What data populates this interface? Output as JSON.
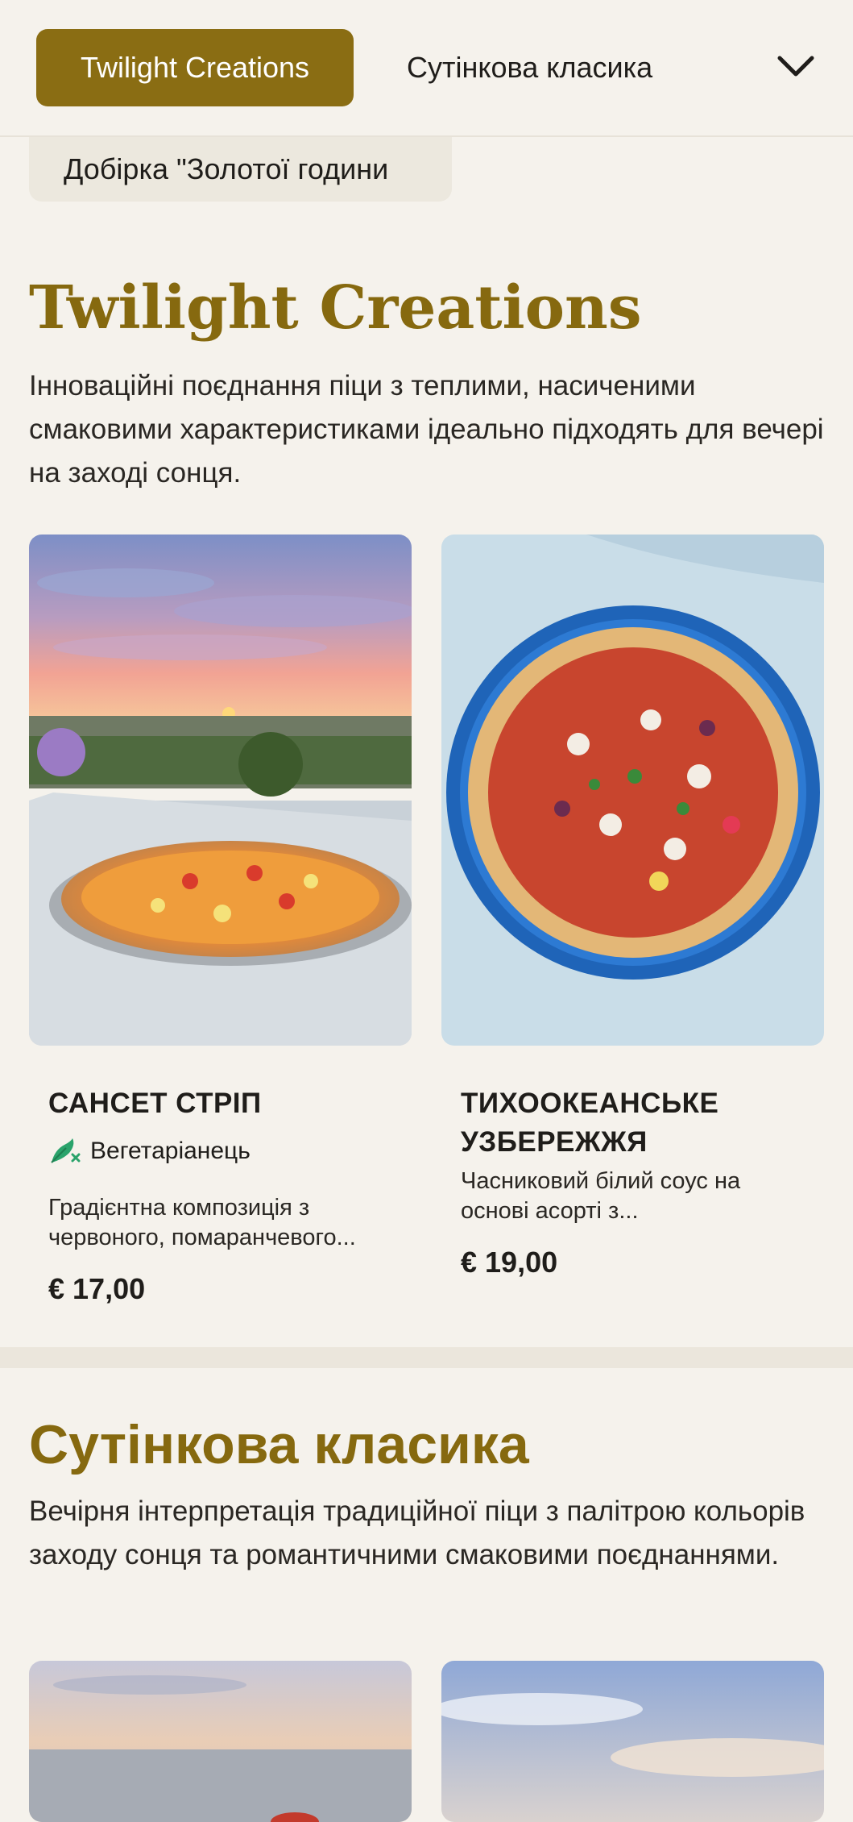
{
  "nav": {
    "tabs": [
      {
        "label": "Twilight Creations",
        "active": true
      },
      {
        "label": "Сутінкова класика",
        "active": false
      },
      {
        "label": "Добірка \"Золотої години",
        "active": false
      }
    ],
    "menu_icon": "chevron-down-icon"
  },
  "sections": [
    {
      "title": "Twilight Creations",
      "description": "Інноваційні поєднання піци з теплими, насиченими смаковими характеристиками ідеально підходять для вечері на заході сонця.",
      "items": [
        {
          "name": "САНСЕТ СТРІП",
          "tag": "Вегетаріанець",
          "tag_icon": "vegetarian-icon",
          "description": "Градієнтна композиція з червоного, помаранчевого...",
          "price": "€ 17,00"
        },
        {
          "name": "ТИХООКЕАНСЬКЕ УЗБЕРЕЖЖЯ",
          "description": "Часниковий білий соус на основі асорті з...",
          "price": "€ 19,00"
        }
      ]
    },
    {
      "title": "Сутінкова класика",
      "description": "Вечірня інтерпретація традиційної піци з палітрою кольорів заходу сонця та романтичними смаковими поєднаннями."
    }
  ],
  "colors": {
    "accent": "#8a6d13",
    "background": "#f5f2ec",
    "chip_bg": "#ece8de",
    "vegetarian_green": "#2aa36b"
  }
}
